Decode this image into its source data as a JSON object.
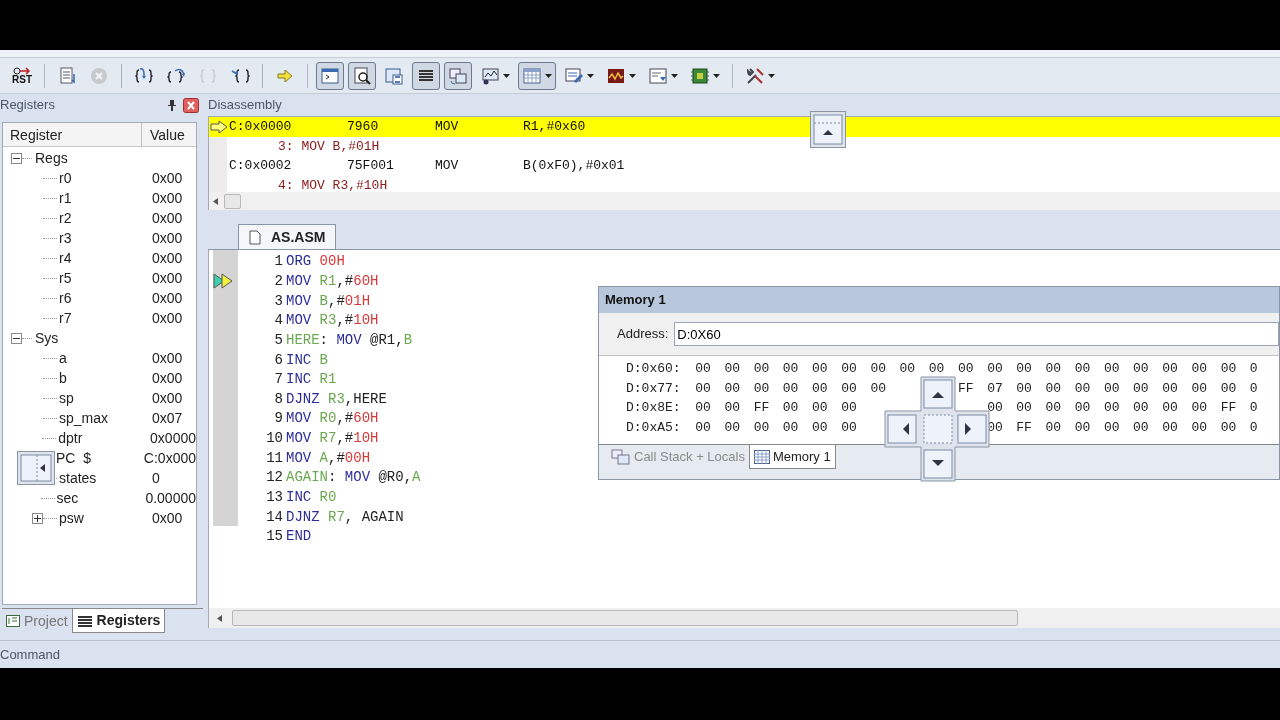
{
  "toolbar": {
    "groups": [
      [
        {
          "kind": "reset",
          "label": "RST",
          "pressed": false,
          "disabled": false,
          "dropdown": false
        }
      ],
      [
        {
          "kind": "document",
          "pressed": false,
          "disabled": false,
          "dropdown": false
        },
        {
          "kind": "stop",
          "pressed": false,
          "disabled": true,
          "dropdown": false
        }
      ],
      [
        {
          "kind": "step-into",
          "pressed": false,
          "disabled": false,
          "dropdown": false
        },
        {
          "kind": "step-over",
          "pressed": false,
          "disabled": false,
          "dropdown": false
        },
        {
          "kind": "step-out",
          "pressed": false,
          "disabled": true,
          "dropdown": false
        },
        {
          "kind": "run-to",
          "pressed": false,
          "disabled": false,
          "dropdown": false
        }
      ],
      [
        {
          "kind": "next",
          "pressed": false,
          "disabled": false,
          "dropdown": false
        }
      ],
      [
        {
          "kind": "command",
          "pressed": true,
          "disabled": false,
          "dropdown": false
        },
        {
          "kind": "disassembly",
          "pressed": true,
          "disabled": false,
          "dropdown": false
        },
        {
          "kind": "symbols",
          "pressed": false,
          "disabled": false,
          "dropdown": false
        },
        {
          "kind": "registers",
          "pressed": true,
          "disabled": false,
          "dropdown": false
        },
        {
          "kind": "callstack",
          "pressed": true,
          "disabled": false,
          "dropdown": false
        },
        {
          "kind": "watch",
          "pressed": false,
          "disabled": false,
          "dropdown": true
        },
        {
          "kind": "memory",
          "pressed": true,
          "disabled": false,
          "dropdown": true
        },
        {
          "kind": "serial",
          "pressed": false,
          "disabled": false,
          "dropdown": true
        },
        {
          "kind": "analysis",
          "pressed": false,
          "disabled": false,
          "dropdown": true
        },
        {
          "kind": "trace",
          "pressed": false,
          "disabled": false,
          "dropdown": true
        },
        {
          "kind": "chip",
          "pressed": false,
          "disabled": false,
          "dropdown": true
        }
      ],
      [
        {
          "kind": "tools",
          "pressed": false,
          "disabled": false,
          "dropdown": true
        }
      ]
    ]
  },
  "registers_panel": {
    "title": "Registers",
    "columns": [
      "Register",
      "Value"
    ],
    "tree": [
      {
        "name": "Regs",
        "expanded": true,
        "children": [
          {
            "name": "r0",
            "value": "0x00"
          },
          {
            "name": "r1",
            "value": "0x00"
          },
          {
            "name": "r2",
            "value": "0x00"
          },
          {
            "name": "r3",
            "value": "0x00"
          },
          {
            "name": "r4",
            "value": "0x00"
          },
          {
            "name": "r5",
            "value": "0x00"
          },
          {
            "name": "r6",
            "value": "0x00"
          },
          {
            "name": "r7",
            "value": "0x00"
          }
        ]
      },
      {
        "name": "Sys",
        "expanded": true,
        "children": [
          {
            "name": "a",
            "value": "0x00"
          },
          {
            "name": "b",
            "value": "0x00"
          },
          {
            "name": "sp",
            "value": "0x00"
          },
          {
            "name": "sp_max",
            "value": "0x07"
          },
          {
            "name": "dptr",
            "value": "0x0000"
          },
          {
            "name": "PC  $",
            "value": "C:0x000"
          },
          {
            "name": "states",
            "value": "0"
          },
          {
            "name": "sec",
            "value": "0.00000"
          },
          {
            "name": "psw",
            "value": "0x00",
            "expanded": false
          }
        ]
      }
    ],
    "tabs": [
      {
        "label": "Project",
        "selected": false
      },
      {
        "label": "Registers",
        "selected": true
      }
    ]
  },
  "disassembly": {
    "title": "Disassembly",
    "rows": [
      {
        "kind": "instruction",
        "address": "C:0x0000",
        "opcode": "7960",
        "mnemonic": "MOV",
        "operands": "R1,#0x60",
        "current": true
      },
      {
        "kind": "source",
        "text": "3: MOV B,#01H"
      },
      {
        "kind": "instruction",
        "address": "C:0x0002",
        "opcode": "75F001",
        "mnemonic": "MOV",
        "operands": "B(0xF0),#0x01",
        "current": false
      },
      {
        "kind": "source",
        "text": "4: MOV R3,#10H"
      }
    ]
  },
  "editor": {
    "tabs": [
      {
        "label": "AS.ASM",
        "selected": true
      }
    ],
    "lines": [
      {
        "number": "1",
        "current": false,
        "tokens": [
          {
            "text": "ORG ",
            "kind": "keyword"
          },
          {
            "text": "00H",
            "kind": "number"
          }
        ]
      },
      {
        "number": "2",
        "current": true,
        "tokens": [
          {
            "text": "MOV ",
            "kind": "keyword"
          },
          {
            "text": "R1",
            "kind": "register"
          },
          {
            "text": ",#",
            "kind": "plain"
          },
          {
            "text": "60H",
            "kind": "number"
          }
        ]
      },
      {
        "number": "3",
        "current": false,
        "tokens": [
          {
            "text": "MOV ",
            "kind": "keyword"
          },
          {
            "text": "B",
            "kind": "register"
          },
          {
            "text": ",#",
            "kind": "plain"
          },
          {
            "text": "01H",
            "kind": "number"
          }
        ]
      },
      {
        "number": "4",
        "current": false,
        "tokens": [
          {
            "text": "MOV ",
            "kind": "keyword"
          },
          {
            "text": "R3",
            "kind": "register"
          },
          {
            "text": ",#",
            "kind": "plain"
          },
          {
            "text": "10H",
            "kind": "number"
          }
        ]
      },
      {
        "number": "5",
        "current": false,
        "tokens": [
          {
            "text": "HERE",
            "kind": "label"
          },
          {
            "text": ": ",
            "kind": "plain"
          },
          {
            "text": "MOV",
            "kind": "keyword"
          },
          {
            "text": " @R1,",
            "kind": "plain"
          },
          {
            "text": "B",
            "kind": "register"
          }
        ]
      },
      {
        "number": "6",
        "current": false,
        "tokens": [
          {
            "text": "INC ",
            "kind": "keyword"
          },
          {
            "text": "B",
            "kind": "register"
          }
        ]
      },
      {
        "number": "7",
        "current": false,
        "tokens": [
          {
            "text": "INC ",
            "kind": "keyword"
          },
          {
            "text": "R1",
            "kind": "register"
          }
        ]
      },
      {
        "number": "8",
        "current": false,
        "tokens": [
          {
            "text": "DJNZ ",
            "kind": "keyword"
          },
          {
            "text": "R3",
            "kind": "register"
          },
          {
            "text": ",HERE",
            "kind": "plain"
          }
        ]
      },
      {
        "number": "9",
        "current": false,
        "tokens": [
          {
            "text": "MOV ",
            "kind": "keyword"
          },
          {
            "text": "R0",
            "kind": "register"
          },
          {
            "text": ",#",
            "kind": "plain"
          },
          {
            "text": "60H",
            "kind": "number"
          }
        ]
      },
      {
        "number": "10",
        "current": false,
        "tokens": [
          {
            "text": "MOV ",
            "kind": "keyword"
          },
          {
            "text": "R7",
            "kind": "register"
          },
          {
            "text": ",#",
            "kind": "plain"
          },
          {
            "text": "10H",
            "kind": "number"
          }
        ]
      },
      {
        "number": "11",
        "current": false,
        "tokens": [
          {
            "text": "MOV ",
            "kind": "keyword"
          },
          {
            "text": "A",
            "kind": "register"
          },
          {
            "text": ",#",
            "kind": "plain"
          },
          {
            "text": "00H",
            "kind": "number"
          }
        ]
      },
      {
        "number": "12",
        "current": false,
        "tokens": [
          {
            "text": "AGAIN",
            "kind": "label"
          },
          {
            "text": ": ",
            "kind": "plain"
          },
          {
            "text": "MOV",
            "kind": "keyword"
          },
          {
            "text": " @R0,",
            "kind": "plain"
          },
          {
            "text": "A",
            "kind": "register"
          }
        ]
      },
      {
        "number": "13",
        "current": false,
        "tokens": [
          {
            "text": "INC ",
            "kind": "keyword"
          },
          {
            "text": "R0",
            "kind": "register"
          }
        ]
      },
      {
        "number": "14",
        "current": false,
        "tokens": [
          {
            "text": "DJNZ ",
            "kind": "keyword"
          },
          {
            "text": "R7",
            "kind": "register"
          },
          {
            "text": ", AGAIN",
            "kind": "plain"
          }
        ]
      },
      {
        "number": "15",
        "current": false,
        "tokens": [
          {
            "text": "END",
            "kind": "keyword"
          }
        ]
      }
    ]
  },
  "memory_window": {
    "title": "Memory 1",
    "address_label": "Address:",
    "address": "D:0X60",
    "rows": [
      {
        "address": "D:0x60:",
        "bytes": [
          "00",
          "00",
          "00",
          "00",
          "00",
          "00",
          "00",
          "00",
          "00",
          "00",
          "00",
          "00",
          "00",
          "00",
          "00",
          "00",
          "00",
          "00",
          "00",
          "0"
        ]
      },
      {
        "address": "D:0x77:",
        "bytes": [
          "00",
          "00",
          "00",
          "00",
          "00",
          "00",
          "00"
        ],
        "bytes_after_guide": [
          "FF",
          "07",
          "00",
          "00",
          "00",
          "00",
          "00",
          "00",
          "00",
          "00",
          "0"
        ]
      },
      {
        "address": "D:0x8E:",
        "bytes": [
          "00",
          "00",
          "FF",
          "00",
          "00",
          "00"
        ],
        "bytes_after_guide": [
          "00",
          "00",
          "00",
          "00",
          "00",
          "00",
          "00",
          "00",
          "FF",
          "0"
        ]
      },
      {
        "address": "D:0xA5:",
        "bytes": [
          "00",
          "00",
          "00",
          "00",
          "00",
          "00"
        ],
        "bytes_after_guide": [
          "00",
          "FF",
          "00",
          "00",
          "00",
          "00",
          "00",
          "00",
          "00",
          "0"
        ]
      }
    ],
    "tabs": [
      {
        "label": "Call Stack + Locals",
        "selected": false
      },
      {
        "label": "Memory 1",
        "selected": true
      }
    ]
  },
  "command_bar": {
    "label": "Command"
  }
}
